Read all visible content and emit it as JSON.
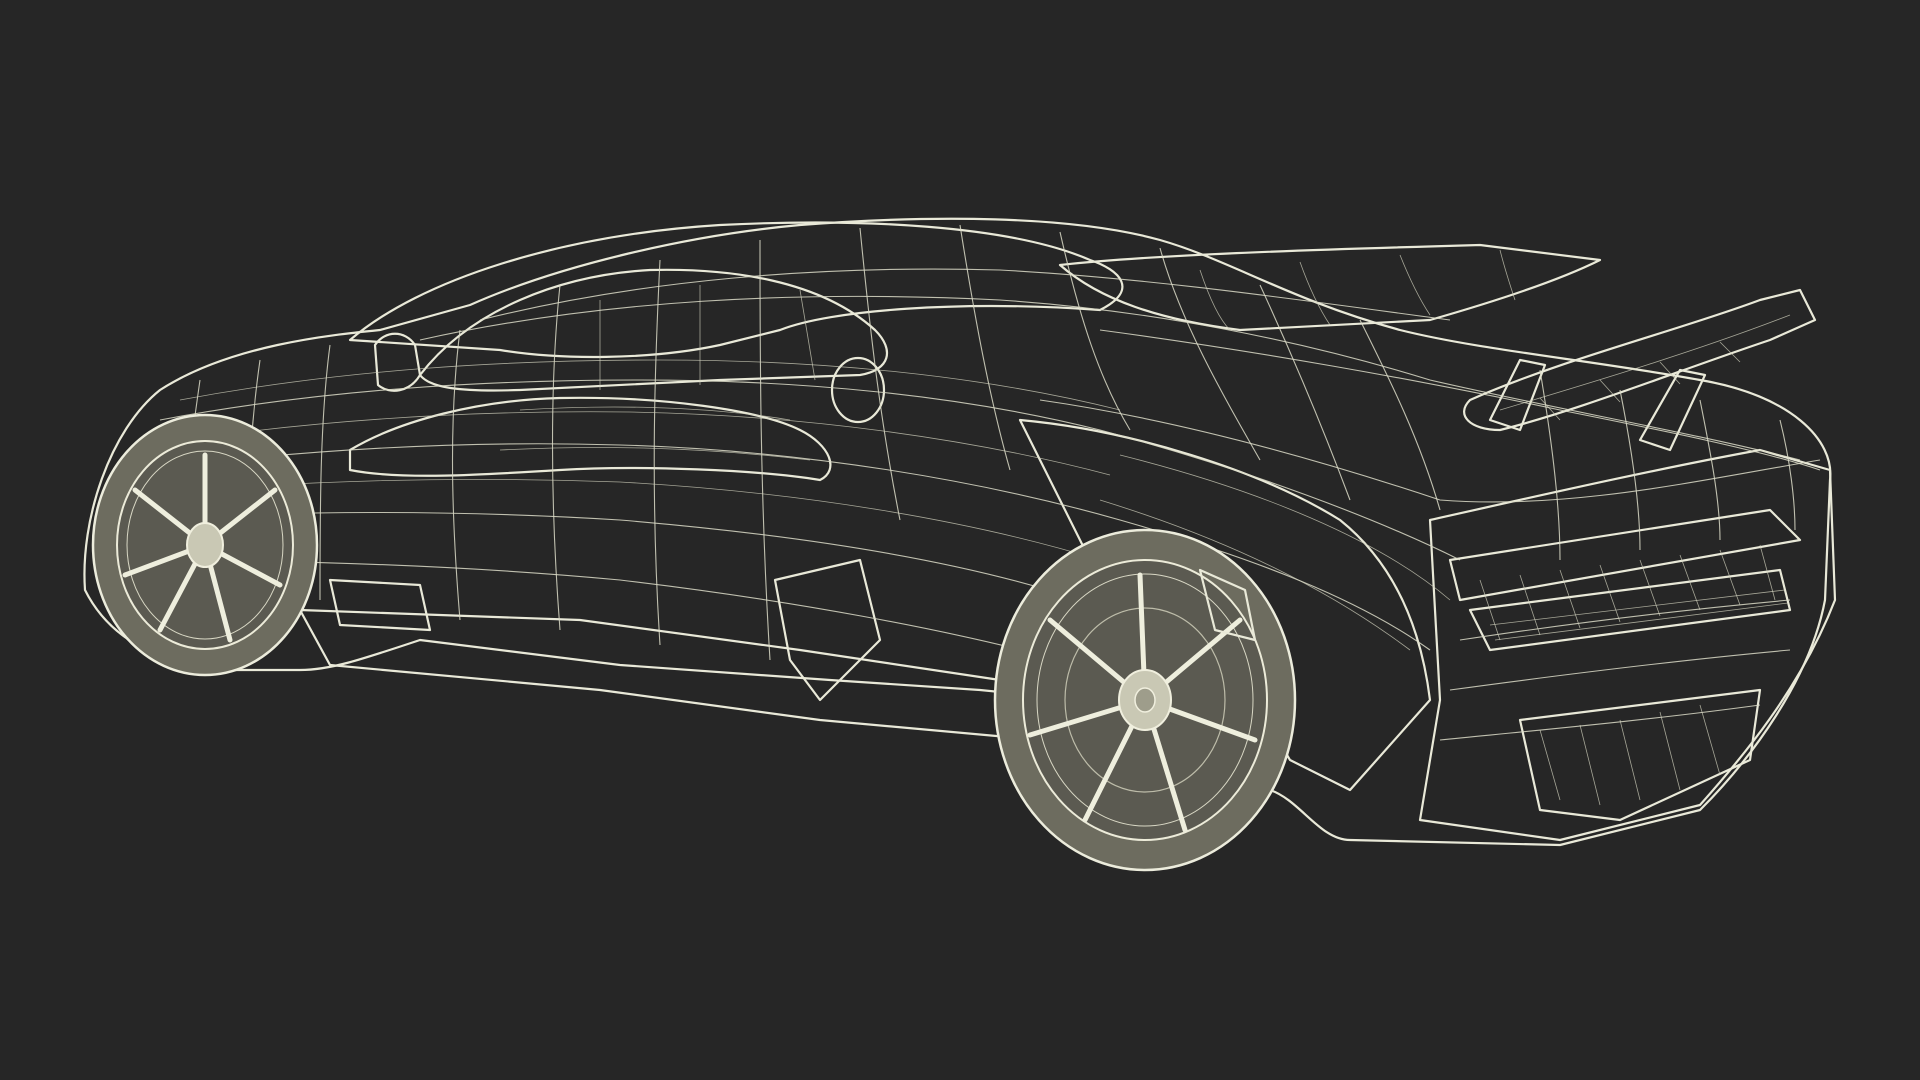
{
  "scene": {
    "subject": "wireframe-render",
    "background_color": "#262626",
    "wire_color": "#e9e9d8",
    "body_color": "#7b7a6b"
  }
}
